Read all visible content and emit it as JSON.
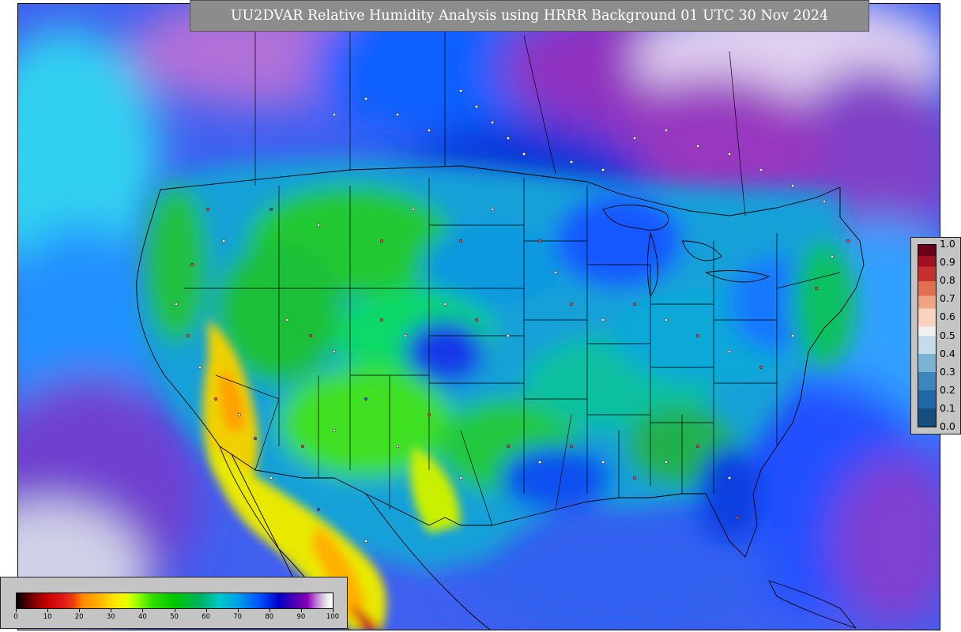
{
  "title": "UU2DVAR Relative Humidity Analysis using HRRR Background 01 UTC 30 Nov 2024",
  "rh_colorbar": {
    "tick_labels": [
      "0",
      "10",
      "20",
      "30",
      "40",
      "50",
      "60",
      "70",
      "80",
      "90",
      "100"
    ],
    "range": [
      0,
      100
    ]
  },
  "error_colorbar": {
    "tick_labels": [
      "1.0",
      "0.9",
      "0.8",
      "0.7",
      "0.6",
      "0.5",
      "0.4",
      "0.3",
      "0.2",
      "0.1",
      "0.0"
    ],
    "range": [
      0.0,
      1.0
    ]
  },
  "colors": {
    "title_background": "#8c8c8c",
    "colorbar_background": "#c4c4c4",
    "ocean_base": "#3f73ff",
    "land_base": "#0a9ad0",
    "state_lines": "#000000"
  },
  "map": {
    "region": "CONUS",
    "observation_markers": "white, red and blue station dots"
  }
}
